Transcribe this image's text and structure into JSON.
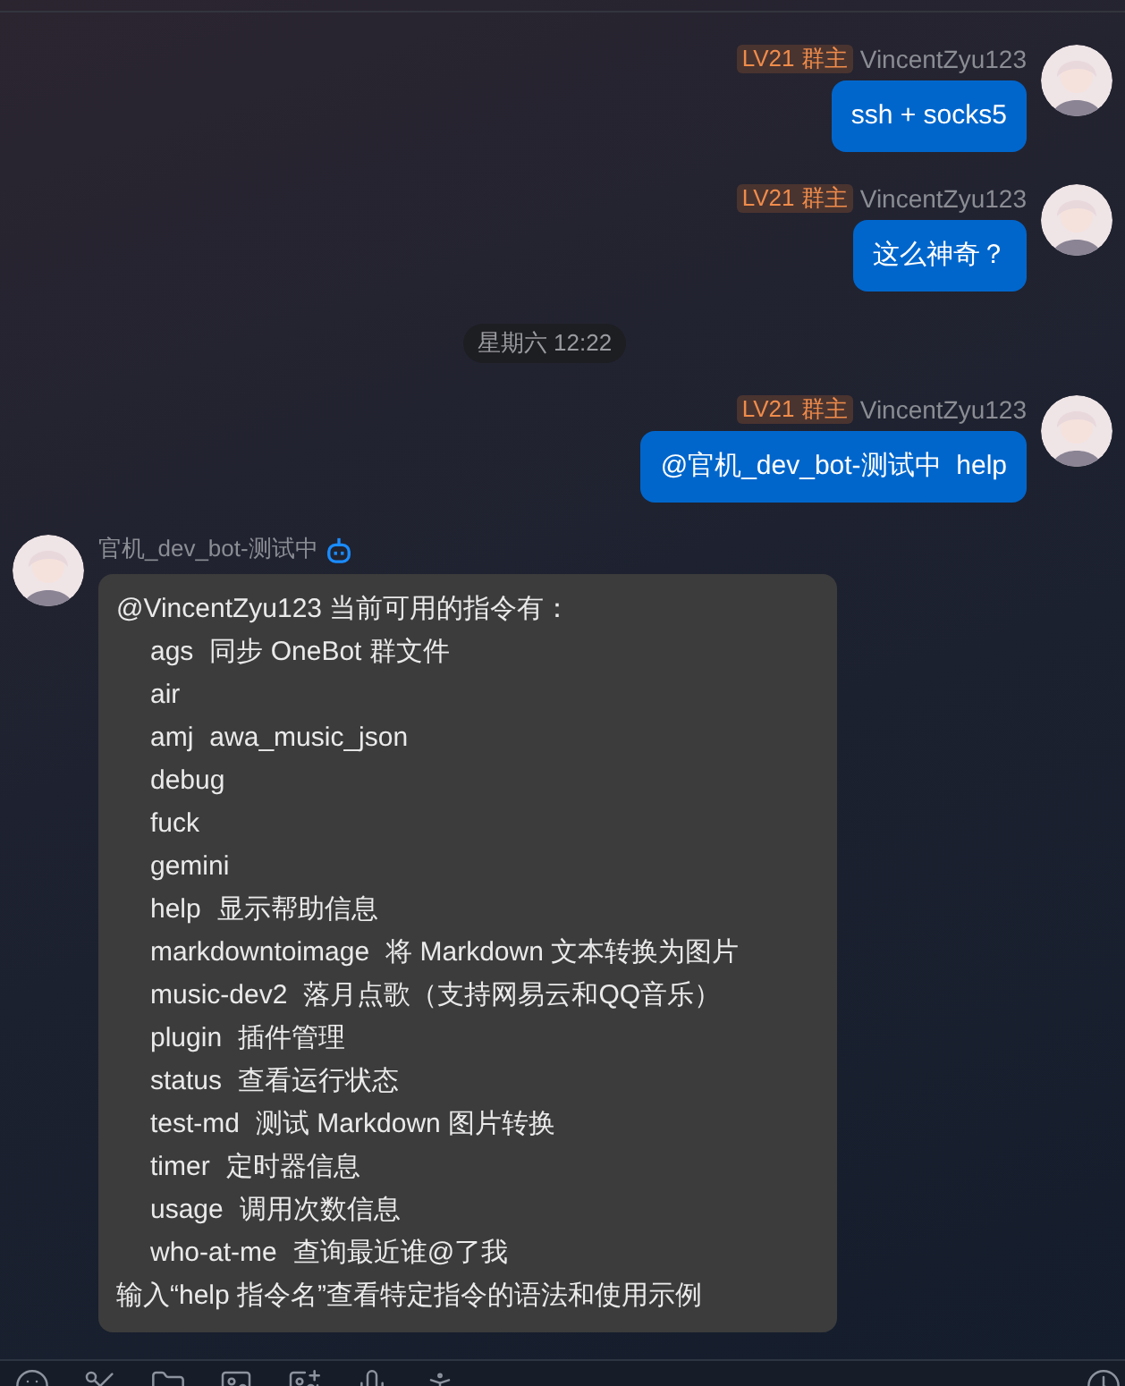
{
  "messages": [
    {
      "kind": "self",
      "badge": "LV21 群主",
      "sender": "VincentZyu123",
      "text": "ssh + socks5"
    },
    {
      "kind": "self",
      "badge": "LV21 群主",
      "sender": "VincentZyu123",
      "text": "这么神奇？"
    },
    {
      "kind": "time",
      "text": "星期六 12:22"
    },
    {
      "kind": "self",
      "badge": "LV21 群主",
      "sender": "VincentZyu123",
      "text": "@官机_dev_bot-测试中  help"
    },
    {
      "kind": "bot",
      "sender": "官机_dev_bot-测试中",
      "intro": "@VincentZyu123 当前可用的指令有：",
      "commands": [
        {
          "name": "ags",
          "desc": "同步 OneBot 群文件"
        },
        {
          "name": "air"
        },
        {
          "name": "amj",
          "desc": "awa_music_json"
        },
        {
          "name": "debug"
        },
        {
          "name": "fuck"
        },
        {
          "name": "gemini"
        },
        {
          "name": "help",
          "desc": "显示帮助信息"
        },
        {
          "name": "markdowntoimage",
          "desc": "将 Markdown 文本转换为图片"
        },
        {
          "name": "music-dev2",
          "desc": "落月点歌（支持网易云和QQ音乐）"
        },
        {
          "name": "plugin",
          "desc": "插件管理"
        },
        {
          "name": "status",
          "desc": "查看运行状态"
        },
        {
          "name": "test-md",
          "desc": "测试 Markdown 图片转换"
        },
        {
          "name": "timer",
          "desc": "定时器信息"
        },
        {
          "name": "usage",
          "desc": "调用次数信息"
        },
        {
          "name": "who-at-me",
          "desc": "查询最近谁@了我"
        }
      ],
      "footer": "输入“help 指令名”查看特定指令的语法和使用示例"
    }
  ]
}
